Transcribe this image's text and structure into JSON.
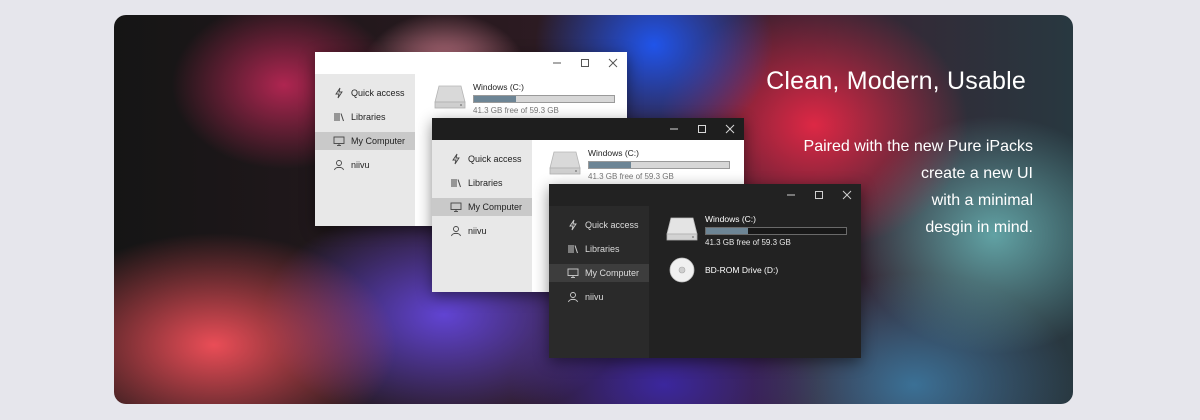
{
  "headline": "Clean, Modern, Usable",
  "description": [
    "Paired with the new Pure iPacks",
    "create a new UI",
    "with a minimal",
    "desgin in mind."
  ],
  "sidebar": {
    "items": [
      {
        "label": "Quick access",
        "icon": "quick-access-icon"
      },
      {
        "label": "Libraries",
        "icon": "libraries-icon"
      },
      {
        "label": "My Computer",
        "icon": "computer-icon",
        "selected": true
      },
      {
        "label": "niivu",
        "icon": "user-icon"
      }
    ]
  },
  "drives": {
    "c": {
      "name": "Windows (C:)",
      "free_text": "41.3 GB free of 59.3 GB",
      "used_fraction": 0.3
    },
    "d": {
      "name": "BD-ROM Drive (D:)"
    }
  },
  "colors": {
    "usage_bar": "#6d8595",
    "dark_bg": "#222222",
    "light_sidebar": "#e8e8e8"
  }
}
